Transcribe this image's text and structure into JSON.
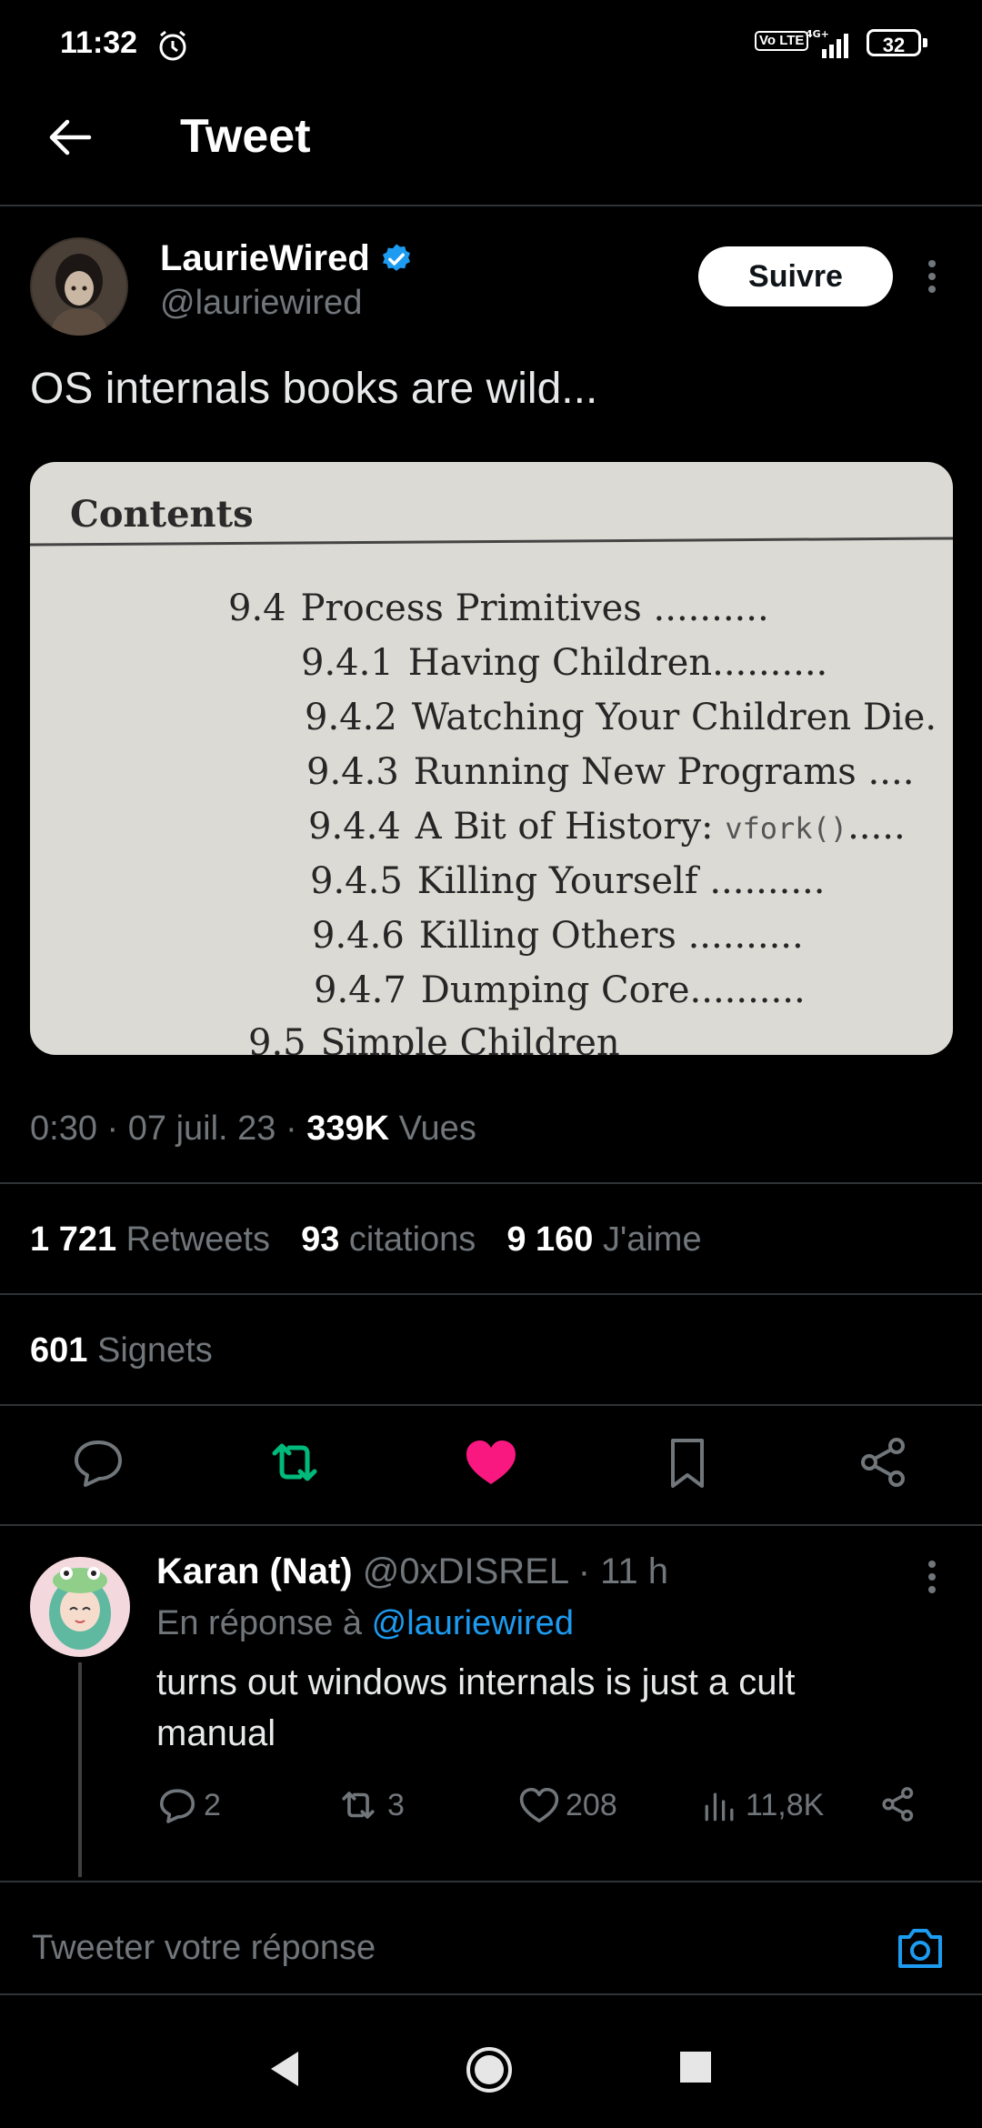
{
  "status_bar": {
    "time": "11:32",
    "network": "4G+",
    "volte": "Vo LTE",
    "battery": "32"
  },
  "header": {
    "title": "Tweet"
  },
  "tweet": {
    "author_name": "LaurieWired",
    "author_handle": "@lauriewired",
    "verified": true,
    "follow_label": "Suivre",
    "text": "OS internals books are wild...",
    "media": {
      "heading": "Contents",
      "entries": [
        {
          "num": "9.4",
          "title": "Process Primitives"
        },
        {
          "num": "9.4.1",
          "title": "Having Children"
        },
        {
          "num": "9.4.2",
          "title": "Watching Your Children Die"
        },
        {
          "num": "9.4.3",
          "title": "Running New Programs"
        },
        {
          "num": "9.4.4",
          "title": "A Bit of History:",
          "code": "vfork()"
        },
        {
          "num": "9.4.5",
          "title": "Killing Yourself"
        },
        {
          "num": "9.4.6",
          "title": "Killing Others"
        },
        {
          "num": "9.4.7",
          "title": "Dumping Core"
        },
        {
          "num": "9.5",
          "title": "Simple Children"
        }
      ]
    },
    "time": "0:30",
    "date": "07 juil. 23",
    "views_count": "339K",
    "views_label": "Vues",
    "retweets_count": "1 721",
    "retweets_label": "Retweets",
    "quotes_count": "93",
    "quotes_label": "citations",
    "likes_count": "9 160",
    "likes_label": "J'aime",
    "bookmarks_count": "601",
    "bookmarks_label": "Signets",
    "liked": true,
    "colors": {
      "retweet": "#00ba7c",
      "like": "#f91880",
      "link": "#1d9bf0"
    }
  },
  "reply": {
    "author_name": "Karan (Nat)",
    "author_handle": "@0xDISREL",
    "time": "11 h",
    "replying_to_label": "En réponse à",
    "replying_to_handle": "@lauriewired",
    "text": "turns out windows internals is just a cult manual",
    "replies": "2",
    "retweets": "3",
    "likes": "208",
    "views": "11,8K"
  },
  "composer": {
    "placeholder": "Tweeter votre réponse"
  }
}
